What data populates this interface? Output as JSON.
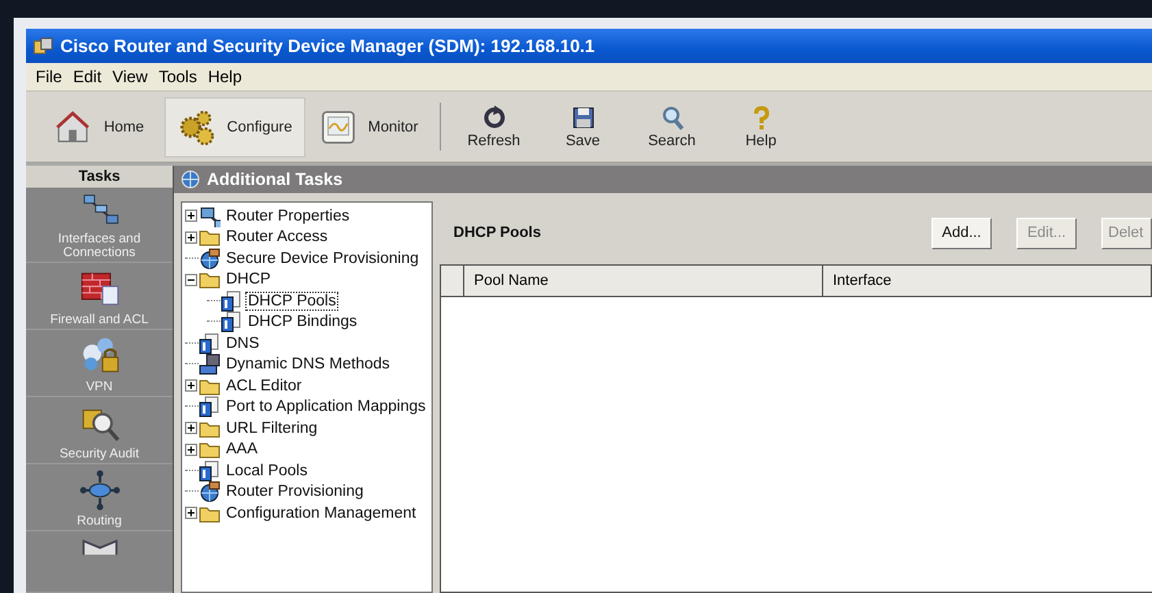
{
  "window": {
    "title": "Cisco Router and Security Device Manager (SDM): 192.168.10.1"
  },
  "menu": [
    "File",
    "Edit",
    "View",
    "Tools",
    "Help"
  ],
  "toolbar": [
    {
      "label": "Home",
      "kind": "large",
      "selected": false
    },
    {
      "label": "Configure",
      "kind": "large",
      "selected": true
    },
    {
      "label": "Monitor",
      "kind": "large",
      "selected": false
    },
    {
      "label": "Refresh",
      "kind": "small",
      "selected": false
    },
    {
      "label": "Save",
      "kind": "small",
      "selected": false
    },
    {
      "label": "Search",
      "kind": "small",
      "selected": false
    },
    {
      "label": "Help",
      "kind": "small",
      "selected": false
    }
  ],
  "sidebar": {
    "title": "Tasks",
    "items": [
      {
        "label": "Interfaces and Connections"
      },
      {
        "label": "Firewall and ACL"
      },
      {
        "label": "VPN"
      },
      {
        "label": "Security Audit"
      },
      {
        "label": "Routing"
      }
    ]
  },
  "section_title": "Additional Tasks",
  "tree": [
    {
      "label": "Router Properties",
      "kind": "network",
      "expanded": false,
      "selected": false
    },
    {
      "label": "Router Access",
      "kind": "folder",
      "expanded": false,
      "selected": false
    },
    {
      "label": "Secure Device Provisioning",
      "kind": "gear",
      "selected": false
    },
    {
      "label": "DHCP",
      "kind": "folder",
      "expanded": true,
      "selected": false,
      "children": [
        {
          "label": "DHCP Pools",
          "kind": "ip",
          "selected": true
        },
        {
          "label": "DHCP Bindings",
          "kind": "ip",
          "selected": false
        }
      ]
    },
    {
      "label": "DNS",
      "kind": "ip",
      "selected": false
    },
    {
      "label": "Dynamic DNS Methods",
      "kind": "device",
      "selected": false
    },
    {
      "label": "ACL Editor",
      "kind": "folder",
      "expanded": false,
      "selected": false
    },
    {
      "label": "Port to Application Mappings",
      "kind": "ip",
      "selected": false
    },
    {
      "label": "URL Filtering",
      "kind": "folder",
      "expanded": false,
      "selected": false
    },
    {
      "label": "AAA",
      "kind": "folder",
      "expanded": false,
      "selected": false
    },
    {
      "label": "Local Pools",
      "kind": "ip",
      "selected": false
    },
    {
      "label": "Router Provisioning",
      "kind": "gear",
      "selected": false
    },
    {
      "label": "Configuration Management",
      "kind": "folder",
      "expanded": false,
      "selected": false
    }
  ],
  "panel": {
    "title": "DHCP Pools",
    "buttons": [
      {
        "label": "Add...",
        "disabled": false
      },
      {
        "label": "Edit...",
        "disabled": true
      },
      {
        "label": "Delet",
        "disabled": true
      }
    ],
    "table": {
      "columns": [
        "Pool Name",
        "Interface"
      ]
    }
  }
}
